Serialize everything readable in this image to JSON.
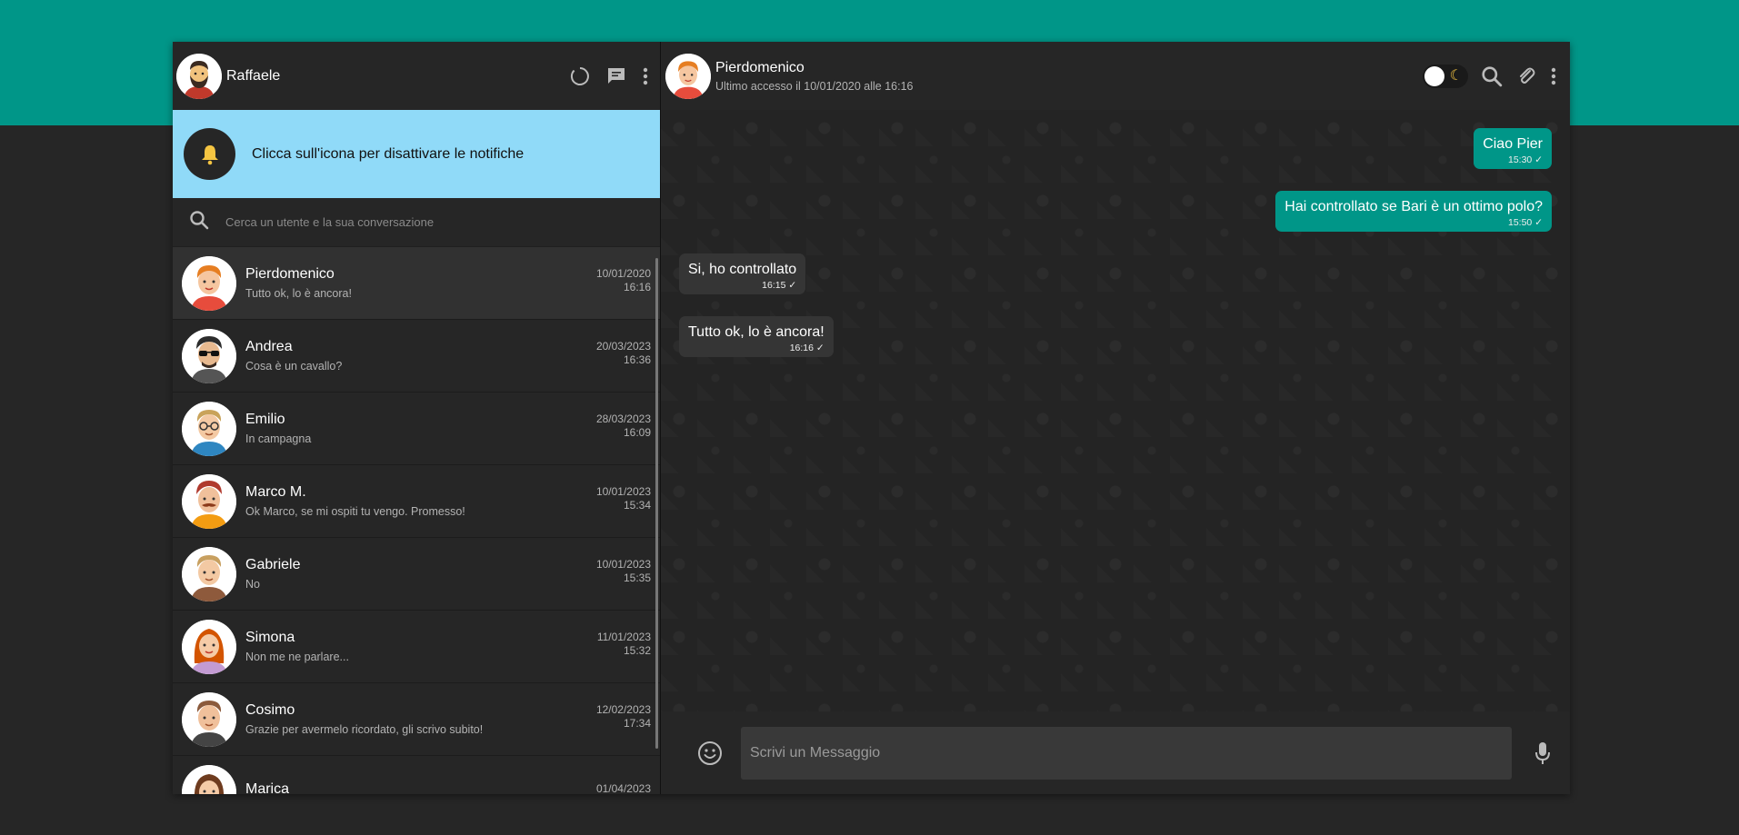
{
  "me": {
    "name": "Raffaele"
  },
  "notifications": {
    "text": "Clicca sull'icona per disattivare le notifiche"
  },
  "search": {
    "placeholder": "Cerca un utente e la sua conversazione"
  },
  "contacts": [
    {
      "name": "Pierdomenico",
      "last": "Tutto ok, lo è ancora!",
      "date": "10/01/2020",
      "time": "16:16"
    },
    {
      "name": "Andrea",
      "last": "Cosa è un cavallo?",
      "date": "20/03/2023",
      "time": "16:36"
    },
    {
      "name": "Emilio",
      "last": "In campagna",
      "date": "28/03/2023",
      "time": "16:09"
    },
    {
      "name": "Marco M.",
      "last": "Ok Marco, se mi ospiti tu vengo. Promesso!",
      "date": "10/01/2023",
      "time": "15:34"
    },
    {
      "name": "Gabriele",
      "last": "No",
      "date": "10/01/2023",
      "time": "15:35"
    },
    {
      "name": "Simona",
      "last": "Non me ne parlare...",
      "date": "11/01/2023",
      "time": "15:32"
    },
    {
      "name": "Cosimo",
      "last": "Grazie per avermelo ricordato, gli scrivo subito!",
      "date": "12/02/2023",
      "time": "17:34"
    },
    {
      "name": "Marica",
      "last": "",
      "date": "01/04/2023",
      "time": ""
    }
  ],
  "chat": {
    "name": "Pierdomenico",
    "status": "Ultimo accesso il 10/01/2020 alle 16:16",
    "messages": [
      {
        "text": "Ciao Pier",
        "time": "15:30",
        "dir": "out"
      },
      {
        "text": "Hai controllato se Bari è un ottimo polo?",
        "time": "15:50",
        "dir": "out"
      },
      {
        "text": "Si, ho controllato",
        "time": "16:15",
        "dir": "in"
      },
      {
        "text": "Tutto ok, lo è ancora!",
        "time": "16:16",
        "dir": "in"
      }
    ]
  },
  "composer": {
    "placeholder": "Scrivi un Messaggio"
  },
  "colors": {
    "accent": "#009688",
    "notify_bg": "#90daf8",
    "panel": "#262626",
    "moon": "#f5c542"
  },
  "icons": [
    "status-icon",
    "chat-icon",
    "menu-dots-icon",
    "bell-icon",
    "search-icon",
    "theme-toggle",
    "attach-icon",
    "emoji-icon",
    "mic-icon",
    "check-icon"
  ]
}
